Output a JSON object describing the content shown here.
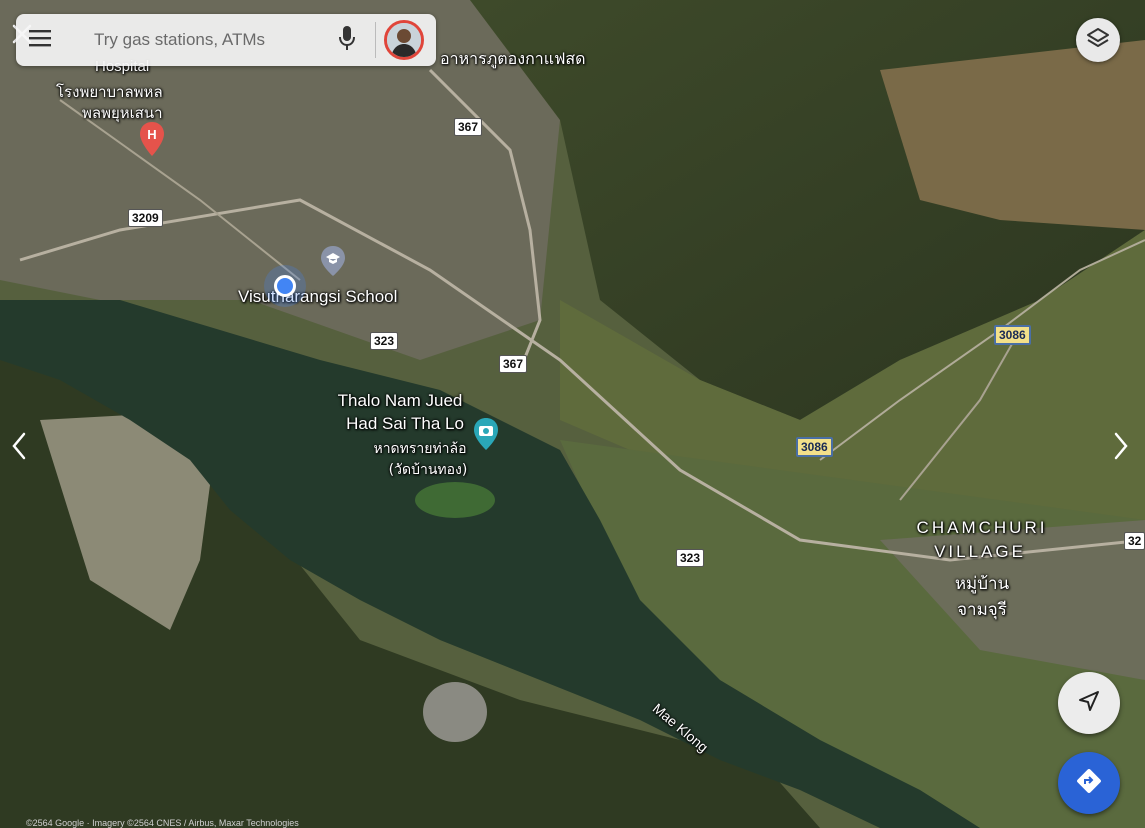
{
  "search": {
    "placeholder": "Try gas stations, ATMs"
  },
  "map": {
    "place_labels": {
      "hospital_en": "Hospital",
      "hospital_th_1": "โรงพยาบาลพหล",
      "hospital_th_2": "พลพยุหเสนา",
      "restaurant_th": "อาหารภูตองกาแฟสด",
      "school": "Visutharangsi School",
      "beach_en_1": "Thalo Nam Jued",
      "beach_en_2": "Had Sai Tha Lo",
      "beach_th_1": "หาดทรายท่าล้อ",
      "beach_th_2": "(วัดบ้านทอง)",
      "village_en_1": "CHAMCHURI",
      "village_en_2": "VILLAGE",
      "village_th_1": "หมู่บ้าน",
      "village_th_2": "จามจุรี",
      "river": "Mae Klong"
    },
    "road_shields": {
      "r367_top": "367",
      "r3209": "3209",
      "r323_a": "323",
      "r367_mid": "367",
      "r3086_a": "3086",
      "r3086_b": "3086",
      "r323_b": "323",
      "r32_edge": "32"
    },
    "attribution": "©2564 Google · Imagery ©2564 CNES / Airbus, Maxar Technologies"
  },
  "icons": {
    "close": "close-icon",
    "menu": "menu-icon",
    "mic": "mic-icon",
    "avatar": "avatar",
    "layers": "layers-icon",
    "hospital_pin": "hospital-pin-icon",
    "school_pin": "school-pin-icon",
    "camera_pin": "camera-pin-icon",
    "locate": "navigation-arrow-icon",
    "directions": "directions-icon",
    "prev": "chevron-left-icon",
    "next": "chevron-right-icon"
  },
  "colors": {
    "blue_dot": "#4285f4",
    "directions_fab": "#2a63d6",
    "hospital_pin": "#e5534b",
    "camera_pin": "#2aa7b8",
    "school_pin": "#8a93a8"
  }
}
